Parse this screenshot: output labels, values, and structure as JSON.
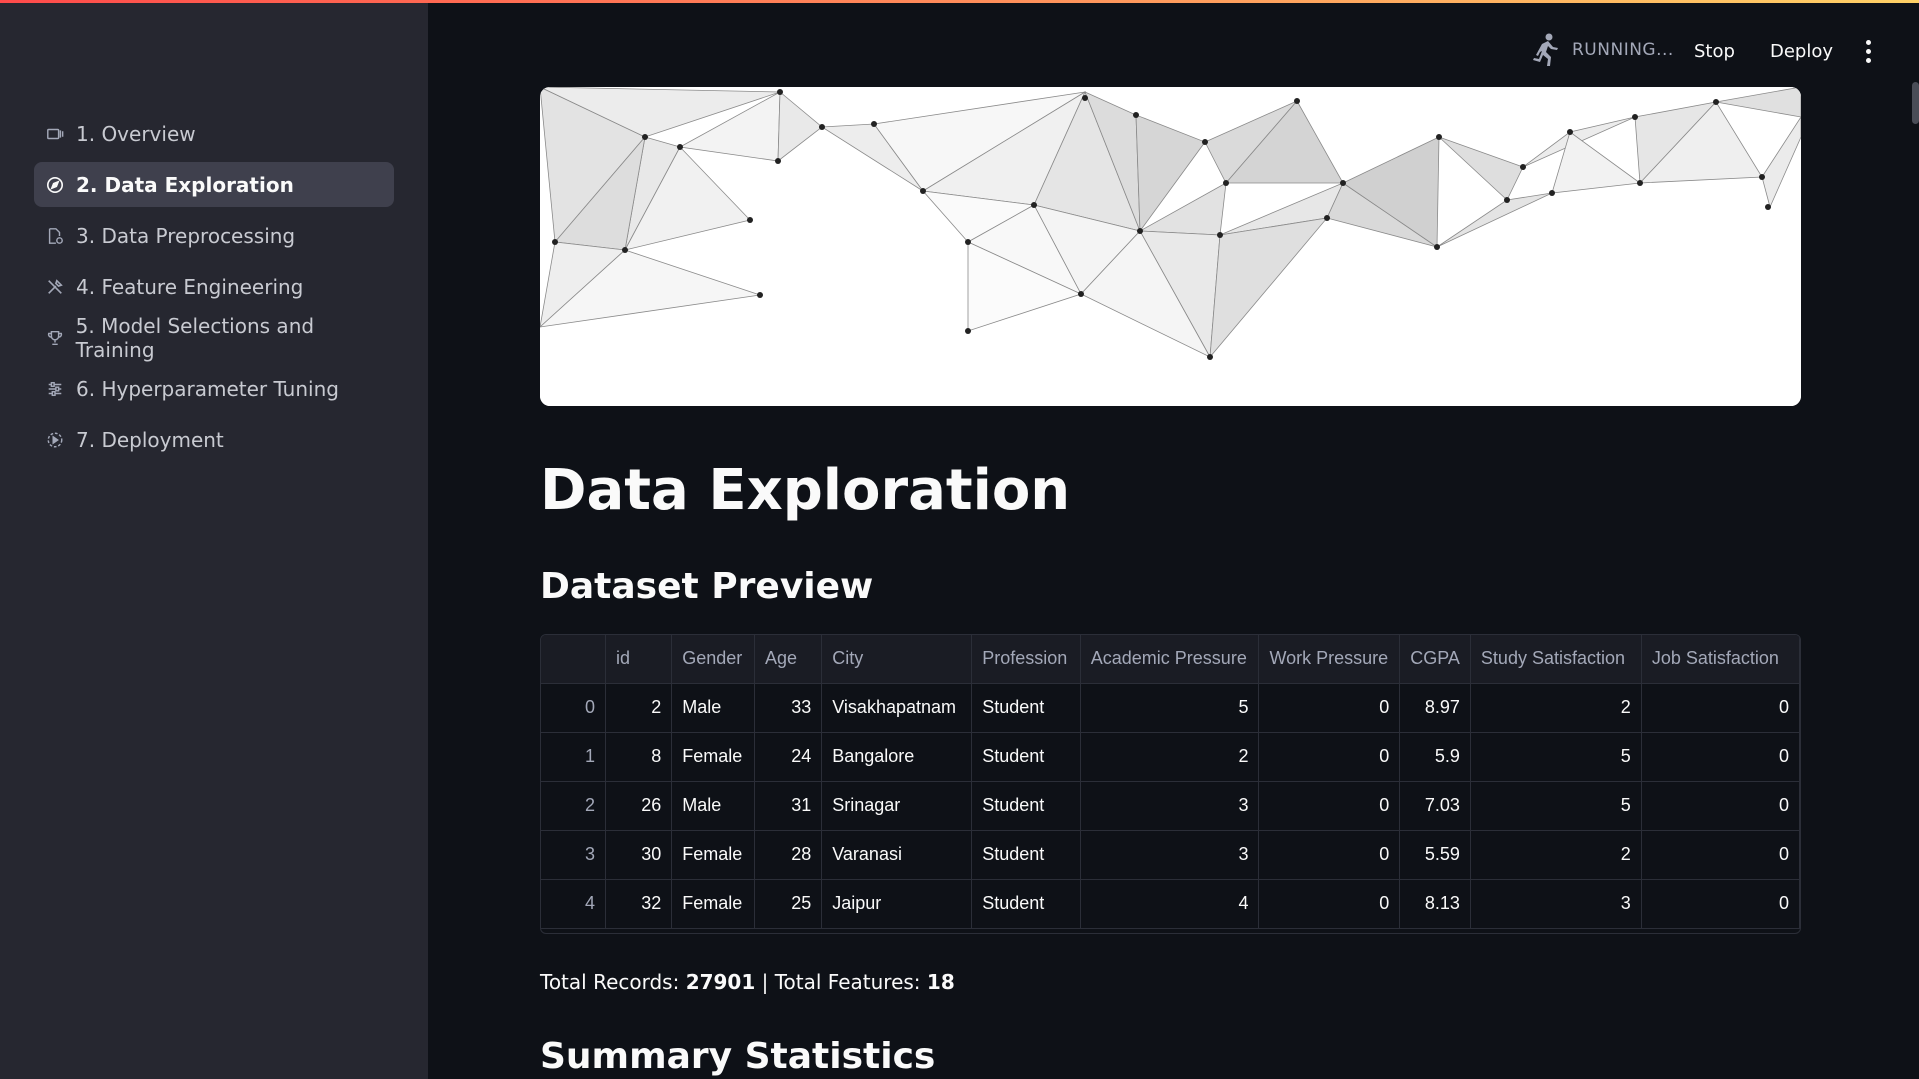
{
  "header": {
    "status": "RUNNING...",
    "stop_label": "Stop",
    "deploy_label": "Deploy"
  },
  "sidebar": {
    "items": [
      {
        "label": "1. Overview",
        "icon": "slideshow-icon"
      },
      {
        "label": "2. Data Exploration",
        "icon": "explore-icon",
        "active": true
      },
      {
        "label": "3. Data Preprocessing",
        "icon": "document-gear-icon"
      },
      {
        "label": "4. Feature Engineering",
        "icon": "tools-icon"
      },
      {
        "label": "5. Model Selections and Training",
        "icon": "trophy-icon"
      },
      {
        "label": "6. Hyperparameter Tuning",
        "icon": "sliders-icon"
      },
      {
        "label": "7. Deployment",
        "icon": "play-circle-icon"
      }
    ]
  },
  "main": {
    "title": "Data Exploration",
    "dataset_preview_heading": "Dataset Preview",
    "summary_heading": "Summary Statistics",
    "records_label": "Total Records:",
    "records_value": "27901",
    "features_label": "| Total Features:",
    "features_value": "18"
  },
  "table": {
    "columns": [
      "",
      "id",
      "Gender",
      "Age",
      "City",
      "Profession",
      "Academic Pressure",
      "Work Pressure",
      "CGPA",
      "Study Satisfaction",
      "Job Satisfaction"
    ],
    "rows": [
      [
        "0",
        "2",
        "Male",
        "33",
        "Visakhapatnam",
        "Student",
        "5",
        "0",
        "8.97",
        "2",
        "0"
      ],
      [
        "1",
        "8",
        "Female",
        "24",
        "Bangalore",
        "Student",
        "2",
        "0",
        "5.9",
        "5",
        "0"
      ],
      [
        "2",
        "26",
        "Male",
        "31",
        "Srinagar",
        "Student",
        "3",
        "0",
        "7.03",
        "5",
        "0"
      ],
      [
        "3",
        "30",
        "Female",
        "28",
        "Varanasi",
        "Student",
        "3",
        "0",
        "5.59",
        "2",
        "0"
      ],
      [
        "4",
        "32",
        "Female",
        "25",
        "Jaipur",
        "Student",
        "4",
        "0",
        "8.13",
        "3",
        "0"
      ]
    ]
  },
  "colors": {
    "background": "#0e1117",
    "sidebar": "#262730",
    "active_item": "#3f404d",
    "accent": "#ff4b4b"
  }
}
